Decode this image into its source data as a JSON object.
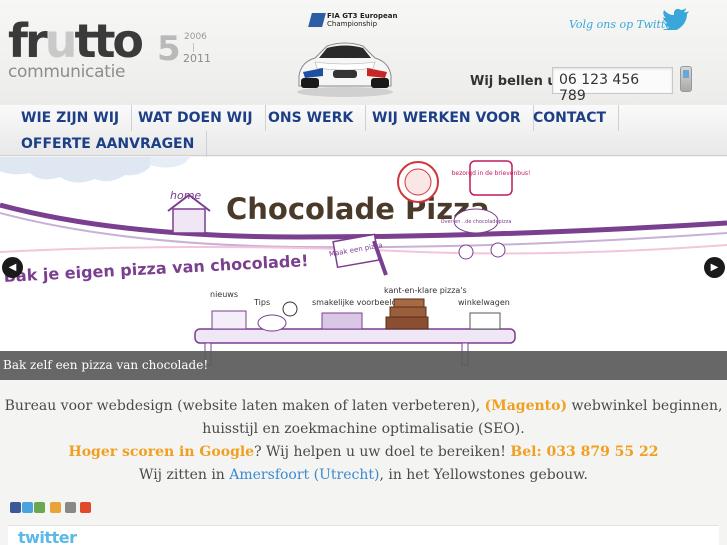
{
  "header": {
    "logo": {
      "main": "frutto",
      "sub": "communicatie"
    },
    "anniversary": {
      "number": "5",
      "year_start": "2006",
      "year_end": "2011"
    },
    "sponsor": {
      "line1": "FIA GT3 European",
      "line2": "Championship"
    },
    "twitter_follow": "Volg ons op Twitter",
    "phone_label": "Wij bellen u:",
    "phone_value": "06 123 456 789"
  },
  "nav": {
    "items": [
      {
        "label": "WIE ZIJN WIJ"
      },
      {
        "label": "WAT DOEN WIJ"
      },
      {
        "label": "ONS WERK"
      },
      {
        "label": "WIJ WERKEN VOOR"
      },
      {
        "label": "CONTACT"
      },
      {
        "label": "OFFERTE AANVRAGEN"
      }
    ]
  },
  "banner": {
    "title": "Chocolade Pizza",
    "slogan": "Bak je eigen pizza van chocolade!",
    "home": "home",
    "badge_top": "bezorgd in de brievenbus!",
    "badge_small": "Over en ..de chocoladepizza",
    "sign": "Maak een pizza",
    "labels": [
      "nieuws",
      "Tips",
      "smakelijke voorbeelden",
      "kant-en-klare pizza's",
      "winkelwagen"
    ],
    "caption": "Bak zelf een pizza van chocolade!",
    "prev_icon": "chevron-left-icon",
    "next_icon": "chevron-right-icon"
  },
  "content": {
    "line1_a": "Bureau voor webdesign (website laten maken of laten verbeteren), ",
    "line1_link": "(Magento)",
    "line1_b": " webwinkel beginnen,",
    "line2": "huisstijl en zoekmachine optimalisatie (SEO).",
    "line3_a": "Hoger scoren in Google",
    "line3_b": "? Wij helpen u uw doel te bereiken! ",
    "line3_c": "Bel: 033 879 55 22",
    "line4_a": "Wij zitten in ",
    "line4_link": "Amersfoort (Utrecht)",
    "line4_b": ", in het Yellowstones gebouw."
  },
  "social": {
    "icons": [
      "facebook-icon",
      "twitter-icon",
      "google-icon",
      "favorite-icon",
      "print-icon",
      "add-icon"
    ],
    "colors": [
      "#3b5998",
      "#4aa3df",
      "#6aa84f",
      "#e8a33a",
      "#888888",
      "#e04a2a"
    ]
  },
  "twitter_widget": {
    "title": "twitter"
  }
}
